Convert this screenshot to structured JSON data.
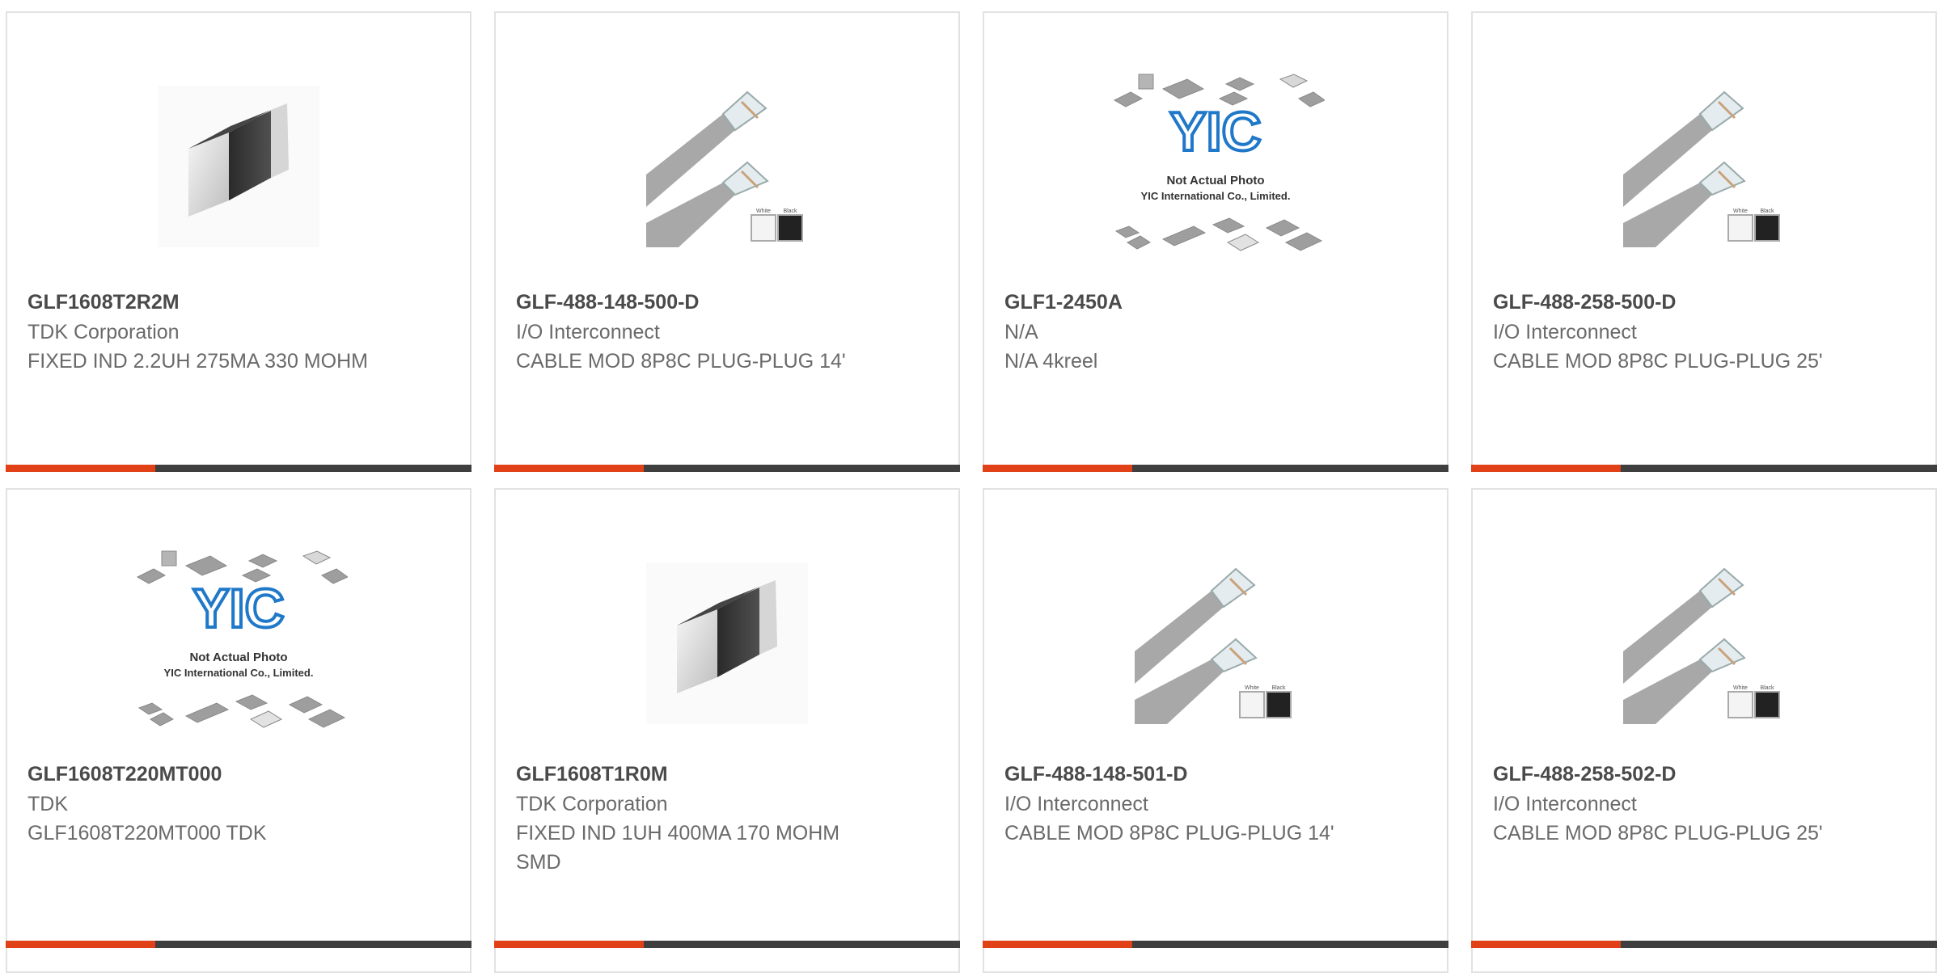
{
  "products": [
    {
      "part": "GLF1608T2R2M",
      "manufacturer": "TDK Corporation",
      "description": "FIXED IND 2.2UH 275MA 330 MOHM",
      "image": "chip-inductor-photo"
    },
    {
      "part": "GLF-488-148-500-D",
      "manufacturer": "I/O Interconnect",
      "description": "CABLE MOD 8P8C PLUG-PLUG 14'",
      "image": "modular-cable-photo"
    },
    {
      "part": "GLF1-2450A",
      "manufacturer": "N/A",
      "description": "N/A 4kreel",
      "image": "placeholder-not-actual-photo"
    },
    {
      "part": "GLF-488-258-500-D",
      "manufacturer": "I/O Interconnect",
      "description": "CABLE MOD 8P8C PLUG-PLUG 25'",
      "image": "modular-cable-photo"
    },
    {
      "part": "GLF1608T220MT000",
      "manufacturer": "TDK",
      "description": "GLF1608T220MT000 TDK",
      "image": "placeholder-not-actual-photo"
    },
    {
      "part": "GLF1608T1R0M",
      "manufacturer": "TDK Corporation",
      "description": "FIXED IND 1UH 400MA 170 MOHM SMD",
      "image": "chip-inductor-photo"
    },
    {
      "part": "GLF-488-148-501-D",
      "manufacturer": "I/O Interconnect",
      "description": "CABLE MOD 8P8C PLUG-PLUG 14'",
      "image": "modular-cable-photo"
    },
    {
      "part": "GLF-488-258-502-D",
      "manufacturer": "I/O Interconnect",
      "description": "CABLE MOD 8P8C PLUG-PLUG 25'",
      "image": "modular-cable-photo"
    }
  ],
  "placeholder": {
    "logo": "YIC",
    "line1": "Not Actual Photo",
    "line2": "YIC International Co., Limited."
  },
  "cable_swatch_labels": {
    "white": "White",
    "black": "Black"
  },
  "colors": {
    "accent_bar": "#e04117",
    "dark_bar": "#3f3f3f",
    "card_border": "#e2e2e2",
    "logo_blue": "#1f78c8"
  }
}
